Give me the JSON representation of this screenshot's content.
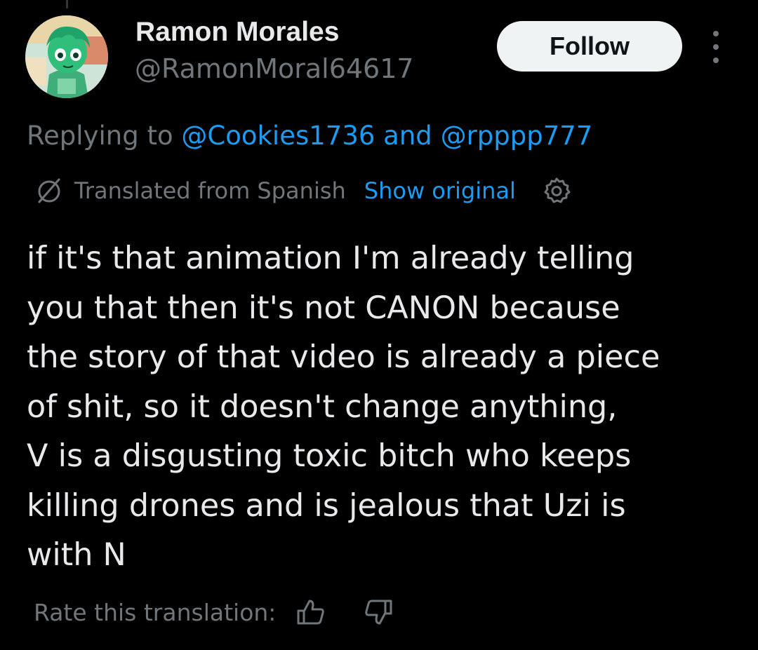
{
  "user": {
    "name": "Ramon Morales",
    "handle": "@RamonMoral64617"
  },
  "follow_button": {
    "label": "Follow"
  },
  "reply_context": {
    "prefix": "Replying to",
    "mention_1": "@Cookies1736",
    "conjunction": "and",
    "mention_2": "@rpppp777"
  },
  "translation": {
    "notice": "Translated from Spanish",
    "show_original": "Show original"
  },
  "tweet": {
    "lines": [
      "if it's that animation I'm already telling",
      "you that then it's not CANON because",
      "the story of that video is already a piece",
      "of shit, so it doesn't change anything,",
      "V is a disgusting toxic bitch who keeps",
      "killing drones and is jealous that Uzi is",
      "with N"
    ]
  },
  "rate": {
    "label": "Rate this translation:"
  },
  "icons": {
    "avatar": "anime-avatar",
    "translate": "globe-slash-icon",
    "settings": "gear-icon",
    "more": "more-vertical-icon",
    "thumb_up": "thumbs-up-icon",
    "thumb_down": "thumbs-down-icon"
  },
  "colors": {
    "background": "#000000",
    "primary_text": "#e7e9ea",
    "secondary_text": "#71767b",
    "link": "#1d9bf0",
    "follow_bg": "#eff3f4",
    "follow_text": "#0f1419"
  }
}
